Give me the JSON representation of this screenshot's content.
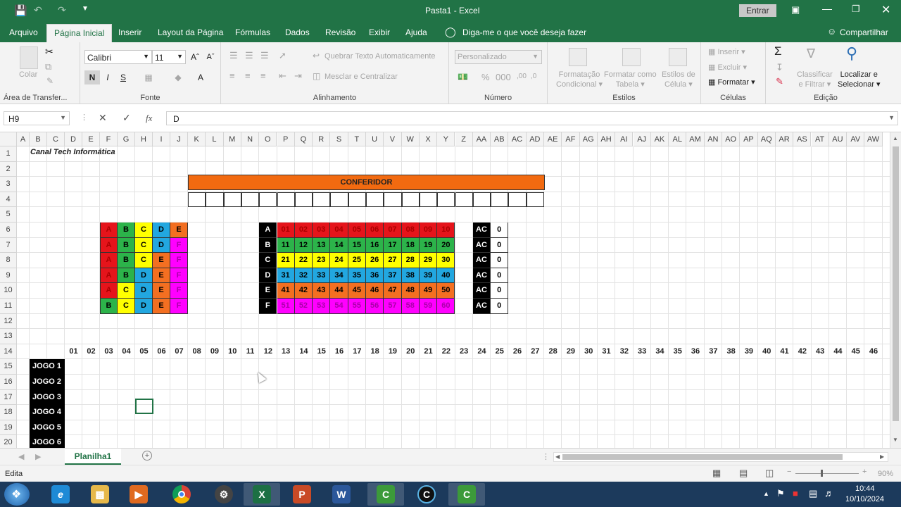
{
  "window": {
    "title": "Pasta1  -  Excel",
    "signin": "Entrar"
  },
  "tabs": [
    "Arquivo",
    "Página Inicial",
    "Inserir",
    "Layout da Página",
    "Fórmulas",
    "Dados",
    "Revisão",
    "Exibir",
    "Ajuda"
  ],
  "tell_me": "Diga-me o que você deseja fazer",
  "share": "Compartilhar",
  "ribbon": {
    "clipboard": {
      "paste": "Colar",
      "label": "Área de Transfer..."
    },
    "font": {
      "name": "Calibri",
      "size": "11",
      "bold": "N",
      "italic": "I",
      "underline": "S",
      "label": "Fonte"
    },
    "alignment": {
      "wrap": "Quebrar Texto Automaticamente",
      "merge": "Mesclar e Centralizar",
      "label": "Alinhamento"
    },
    "number": {
      "format": "Personalizado",
      "label": "Número"
    },
    "styles": {
      "conditional": [
        "Formatação",
        "Condicional"
      ],
      "table": [
        "Formatar como",
        "Tabela"
      ],
      "cell": [
        "Estilos de",
        "Célula"
      ],
      "label": "Estilos"
    },
    "cells": {
      "insert": "Inserir",
      "delete": "Excluir",
      "format": "Formatar",
      "label": "Células"
    },
    "editing": {
      "sort": [
        "Classificar",
        "e Filtrar"
      ],
      "find": [
        "Localizar e",
        "Selecionar"
      ],
      "label": "Edição"
    }
  },
  "formula_bar": {
    "name_box": "H9",
    "fx": "fx",
    "value": "D"
  },
  "columns": [
    "A",
    "B",
    "C",
    "D",
    "E",
    "F",
    "G",
    "H",
    "I",
    "J",
    "K",
    "L",
    "M",
    "N",
    "O",
    "P",
    "Q",
    "R",
    "S",
    "T",
    "U",
    "V",
    "W",
    "X",
    "Y",
    "Z",
    "AA",
    "AB",
    "AC",
    "AD",
    "AE",
    "AF",
    "AG",
    "AH",
    "AI",
    "AJ",
    "AK",
    "AL",
    "AM",
    "AN",
    "AO",
    "AP",
    "AQ",
    "AR",
    "AS",
    "AT",
    "AU",
    "AV",
    "AW"
  ],
  "rows": [
    "1",
    "2",
    "3",
    "4",
    "5",
    "6",
    "7",
    "8",
    "9",
    "10",
    "11",
    "12",
    "13",
    "14",
    "15",
    "16",
    "17",
    "18",
    "19",
    "20"
  ],
  "sheet": {
    "title_cell": "Canal Tech Informática",
    "conferidor": "CONFERIDOR",
    "letter_grid": [
      [
        "A",
        "B",
        "C",
        "D",
        "E"
      ],
      [
        "A",
        "B",
        "C",
        "D",
        "F"
      ],
      [
        "A",
        "B",
        "C",
        "E",
        "F"
      ],
      [
        "A",
        "B",
        "D",
        "E",
        "F"
      ],
      [
        "A",
        "C",
        "D",
        "E",
        "F"
      ],
      [
        "B",
        "C",
        "D",
        "E",
        "F"
      ]
    ],
    "number_grid": [
      {
        "letter": "A",
        "nums": [
          "01",
          "02",
          "03",
          "04",
          "05",
          "06",
          "07",
          "08",
          "09",
          "10"
        ]
      },
      {
        "letter": "B",
        "nums": [
          "11",
          "12",
          "13",
          "14",
          "15",
          "16",
          "17",
          "18",
          "19",
          "20"
        ]
      },
      {
        "letter": "C",
        "nums": [
          "21",
          "22",
          "23",
          "24",
          "25",
          "26",
          "27",
          "28",
          "29",
          "30"
        ]
      },
      {
        "letter": "D",
        "nums": [
          "31",
          "32",
          "33",
          "34",
          "35",
          "36",
          "37",
          "38",
          "39",
          "40"
        ]
      },
      {
        "letter": "E",
        "nums": [
          "41",
          "42",
          "43",
          "44",
          "45",
          "46",
          "47",
          "48",
          "49",
          "50"
        ]
      },
      {
        "letter": "F",
        "nums": [
          "51",
          "52",
          "53",
          "54",
          "55",
          "56",
          "57",
          "58",
          "59",
          "60"
        ]
      }
    ],
    "ac_label": "AC",
    "ac_values": [
      "0",
      "0",
      "0",
      "0",
      "0",
      "0"
    ],
    "header_numbers": [
      "01",
      "02",
      "03",
      "04",
      "05",
      "06",
      "07",
      "08",
      "09",
      "10",
      "11",
      "12",
      "13",
      "14",
      "15",
      "16",
      "17",
      "18",
      "19",
      "20",
      "21",
      "22",
      "23",
      "24",
      "25",
      "26",
      "27",
      "28",
      "29",
      "30",
      "31",
      "32",
      "33",
      "34",
      "35",
      "36",
      "37",
      "38",
      "39",
      "40",
      "41",
      "42",
      "43",
      "44",
      "45",
      "46"
    ],
    "jogos": [
      "JOGO 1",
      "JOGO 2",
      "JOGO 3",
      "JOGO 4",
      "JOGO 5",
      "JOGO 6"
    ]
  },
  "colors": {
    "A": "#e5141b",
    "B": "#2cb34a",
    "C": "#ffff00",
    "D": "#22a7e0",
    "E": "#f36f21",
    "F": "#ff00ff",
    "conferidor": "#f26a10",
    "excel_green": "#217346"
  },
  "sheet_tab": "Planilha1",
  "status": {
    "mode": "Edita",
    "zoom": "90%"
  },
  "clock": {
    "time": "10:44",
    "date": "10/10/2024"
  }
}
